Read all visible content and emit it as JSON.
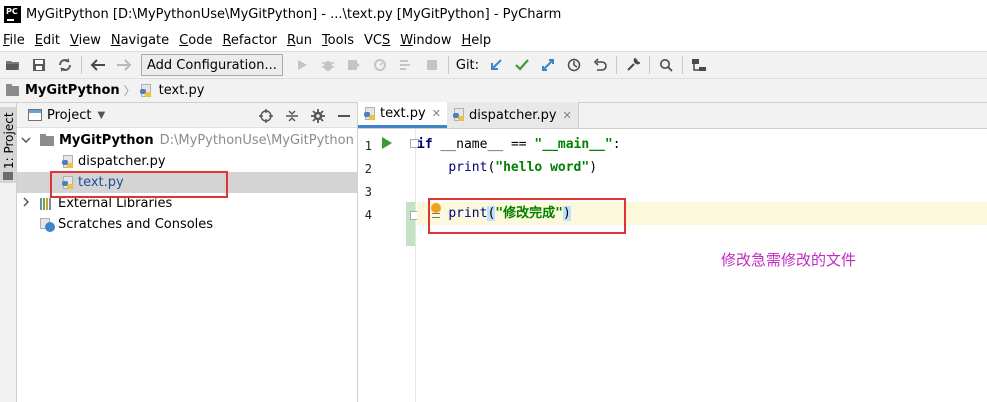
{
  "window": {
    "title": "MyGitPython [D:\\MyPythonUse\\MyGitPython] - ...\\text.py [MyGitPython] - PyCharm",
    "app_icon": "PC"
  },
  "menu": [
    {
      "label": "File",
      "mnemonic": "F",
      "rest": "ile"
    },
    {
      "label": "Edit",
      "mnemonic": "E",
      "rest": "dit"
    },
    {
      "label": "View",
      "mnemonic": "V",
      "rest": "iew"
    },
    {
      "label": "Navigate",
      "mnemonic": "N",
      "rest": "avigate"
    },
    {
      "label": "Code",
      "mnemonic": "C",
      "rest": "ode"
    },
    {
      "label": "Refactor",
      "mnemonic": "R",
      "rest": "efactor"
    },
    {
      "label": "Run",
      "mnemonic": "R",
      "rest": "un"
    },
    {
      "label": "Tools",
      "mnemonic": "T",
      "rest": "ools"
    },
    {
      "label": "VCS",
      "mnemonic": "S",
      "pre": "VC"
    },
    {
      "label": "Window",
      "mnemonic": "W",
      "rest": "indow"
    },
    {
      "label": "Help",
      "mnemonic": "H",
      "rest": "elp"
    }
  ],
  "toolbar": {
    "add_configuration": "Add Configuration...",
    "git_label": "Git:"
  },
  "breadcrumb": {
    "project": "MyGitPython",
    "file": "text.py"
  },
  "left_strip": {
    "label": "1: Project"
  },
  "project_panel": {
    "title": "Project",
    "tree": {
      "root": {
        "name": "MyGitPython",
        "path": "D:\\MyPythonUse\\MyGitPython"
      },
      "files": [
        "dispatcher.py",
        "text.py"
      ],
      "external": "External Libraries",
      "scratches": "Scratches and Consoles"
    }
  },
  "editor": {
    "tabs": [
      {
        "label": "text.py",
        "active": true
      },
      {
        "label": "dispatcher.py",
        "active": false
      }
    ],
    "line_numbers": [
      "1",
      "2",
      "3",
      "4"
    ],
    "code": {
      "l1_kw": "if",
      "l1_name": "__name__",
      "l1_op": "==",
      "l1_str": "\"__main__\"",
      "l1_colon": ":",
      "l2_fn": "print",
      "l2_open": "(",
      "l2_str": "\"hello word\"",
      "l2_close": ")",
      "l4_fn": "print",
      "l4_open": "(",
      "l4_str": "\"修改完成\"",
      "l4_close": ")"
    }
  },
  "annotation": "修改急需修改的文件",
  "colors": {
    "highlight_box": "#e03434",
    "annotation": "#c02cc0",
    "current_line": "#fcf8dc",
    "selected_row": "#d4d4d4"
  }
}
